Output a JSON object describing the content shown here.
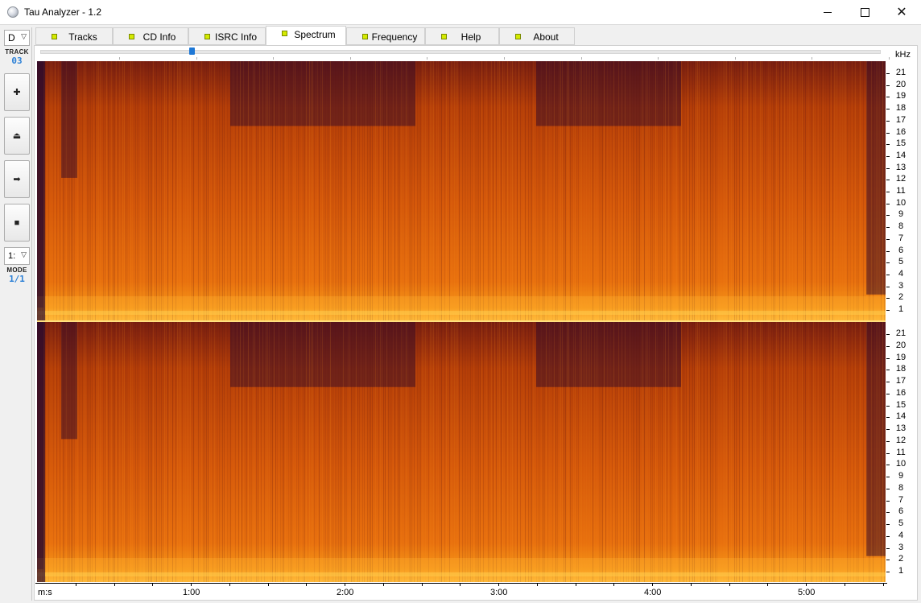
{
  "window": {
    "title": "Tau Analyzer - 1.2",
    "icon": "app-logo-icon",
    "minimize_glyph": "minimize-icon",
    "maximize_glyph": "maximize-icon",
    "close_glyph": "✕"
  },
  "sidebar": {
    "drive_value": "D",
    "track_label": "TRACK",
    "track_number": "03",
    "buttons": [
      {
        "name": "add-button",
        "glyph": "✚",
        "icon": "plus-icon"
      },
      {
        "name": "eject-button",
        "glyph": "⏏",
        "icon": "eject-icon"
      },
      {
        "name": "next-button",
        "glyph": "➡",
        "icon": "arrow-right-icon"
      },
      {
        "name": "stop-button",
        "glyph": "■",
        "icon": "stop-icon"
      }
    ],
    "mode_value": "1:",
    "mode_label": "MODE",
    "mode_number": "1/1"
  },
  "tabs": [
    {
      "label": "Tracks",
      "active": false
    },
    {
      "label": "CD Info",
      "active": false
    },
    {
      "label": "ISRC Info",
      "active": false
    },
    {
      "label": "Spectrum",
      "active": true
    },
    {
      "label": "Frequency",
      "active": false
    },
    {
      "label": "Help",
      "active": false
    },
    {
      "label": "About",
      "active": false
    }
  ],
  "spectrum": {
    "unit_label": "kHz",
    "frequency_ticks": [
      "21",
      "20",
      "19",
      "18",
      "17",
      "16",
      "15",
      "14",
      "13",
      "12",
      "11",
      "10",
      "9",
      "8",
      "7",
      "6",
      "5",
      "4",
      "3",
      "2",
      "1"
    ],
    "time_axis_label": "m:s",
    "time_ticks": [
      "1:00",
      "2:00",
      "3:00",
      "4:00",
      "5:00"
    ],
    "position_slider_fraction": 0.18,
    "colors": {
      "low": "#2a0a2e",
      "mid": "#c44a08",
      "high": "#ff9a1a",
      "peak": "#ffd040"
    }
  }
}
